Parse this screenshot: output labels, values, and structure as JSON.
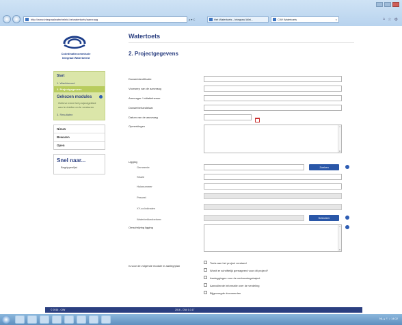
{
  "browser": {
    "address": "http://www.integraalwaterbeleid.be/watertoets/aanvraag",
    "address_tools": "ρ ▾ C",
    "tabs": [
      {
        "label": "Het Watertoets - Integraal Wat..."
      },
      {
        "label": "CIW Watertoets"
      }
    ]
  },
  "logo": {
    "line1": "Coördinatiecommissie",
    "line2": "Integraal Waterbeleid"
  },
  "sidebar": {
    "start_label": "Start",
    "steps": [
      {
        "label": "1. Wachtwoord"
      },
      {
        "label": "2. Projectgegevens"
      }
    ],
    "modules_title": "Gekozen modules",
    "modules_note": "Gelieve eerst het projectgebied aan te duiden en te versturen",
    "result_step": "3. Resultaten",
    "menu": [
      {
        "label": "Nieuw"
      },
      {
        "label": "Bewaren"
      },
      {
        "label": "Open"
      }
    ],
    "brief_title": "Snel naar...",
    "brief_link": "Begrippenlijst"
  },
  "main": {
    "title": "Watertoets",
    "subtitle": "2. Projectgegevens",
    "fields": {
      "dossier_id": "Dossieridentificatie",
      "aanvraag_title": "Voorwerp van de aanvraag",
      "aanvrager_name": "Aanvrager / initiatiefnemer",
      "dossierbehandelaar": "Dossierbehandelaar",
      "datum": "Datum van de aanvraag",
      "opmerkingen": "Opmerkingen",
      "ligging": "Ligging",
      "gemeente": "Gemeente",
      "straat": "Straat",
      "huisnummer": "Huisnummer",
      "perceel": "Perceel",
      "xy": "XY-coördinaten",
      "gebied": "Waterbekkenbeheer",
      "omschrijving": "Omschrijving ligging"
    },
    "buttons": {
      "gemeente_btn": "Zoeken",
      "gebied_btn": "Selecteer"
    },
    "modules_question": "Is voor de volgende module in aanleg/plan",
    "modules": [
      {
        "label": "Toets aan het project verstand"
      },
      {
        "label": "Wordt er schriftelijk gereageerd voor dit project?"
      },
      {
        "label": "Aanleggingen voor de verbouwingstraject"
      },
      {
        "label": "Aanvullende informatie over de verdeling"
      },
      {
        "label": "Bijgevoegde documenten"
      }
    ]
  },
  "footer": {
    "left": "© 2016 - CIW",
    "center": "2016 - CIW 1.0.17"
  },
  "taskbar": {
    "tray_text": "NL ▴ ⚐ ♪ 14:02"
  }
}
